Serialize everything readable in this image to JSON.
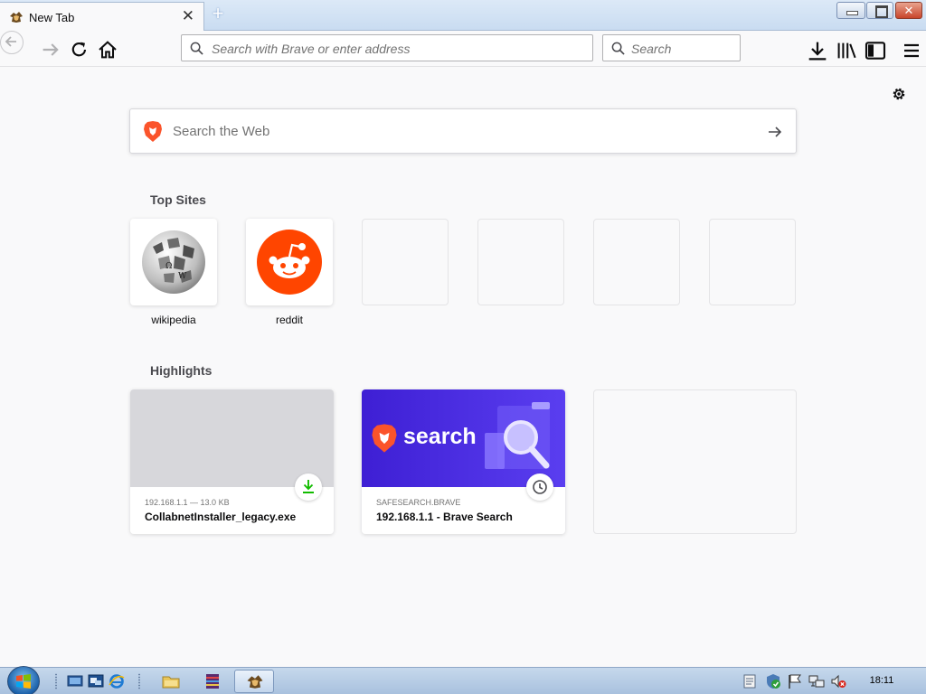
{
  "window": {
    "tab_title": "New Tab",
    "tab_favicon": "brave-lion-icon",
    "new_tab_glyph": "+",
    "close_glyph": "✕"
  },
  "navbar": {
    "address_placeholder": "Search with Brave or enter address",
    "search_placeholder": "Search",
    "icons": [
      "back-icon",
      "forward-icon",
      "reload-icon",
      "home-icon",
      "download-icon",
      "library-icon",
      "sidebar-icon",
      "menu-icon"
    ]
  },
  "newtab": {
    "web_search_placeholder": "Search the Web",
    "top_sites_title": "Top Sites",
    "top_sites": [
      {
        "label": "wikipedia",
        "icon": "wikipedia-globe-icon"
      },
      {
        "label": "reddit",
        "icon": "reddit-alien-icon"
      }
    ],
    "highlights_title": "Highlights",
    "highlights": [
      {
        "context": "192.168.1.1 — 13.0 KB",
        "title": "CollabnetInstaller_legacy.exe",
        "badge": "download-icon"
      },
      {
        "context": "SAFESEARCH.BRAVE",
        "title": "192.168.1.1 - Brave Search",
        "badge": "clock-icon",
        "thumb_text": "search"
      }
    ]
  },
  "taskbar": {
    "clock": "18:11"
  },
  "colors": {
    "reddit": "#ff4500",
    "brave_search_bg": "#4a2ee0",
    "download_green": "#12bc00"
  }
}
